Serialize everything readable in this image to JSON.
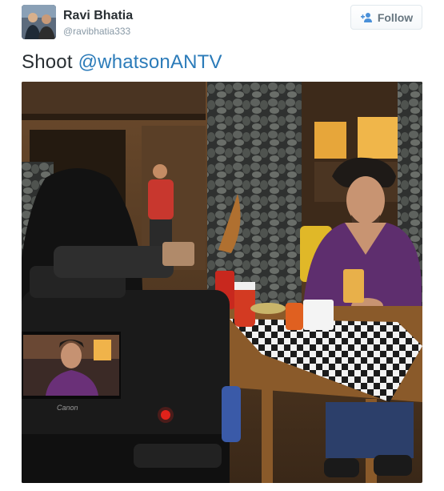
{
  "tweet": {
    "user": {
      "name": "Ravi Bhatia",
      "handle": "@ravibhatia333"
    },
    "follow_label": "Follow",
    "text_prefix": "Shoot ",
    "mention": "@whatsonANTV",
    "accent_color": "#2b7bb9",
    "photo": {
      "camera_brand": "Canon"
    }
  }
}
